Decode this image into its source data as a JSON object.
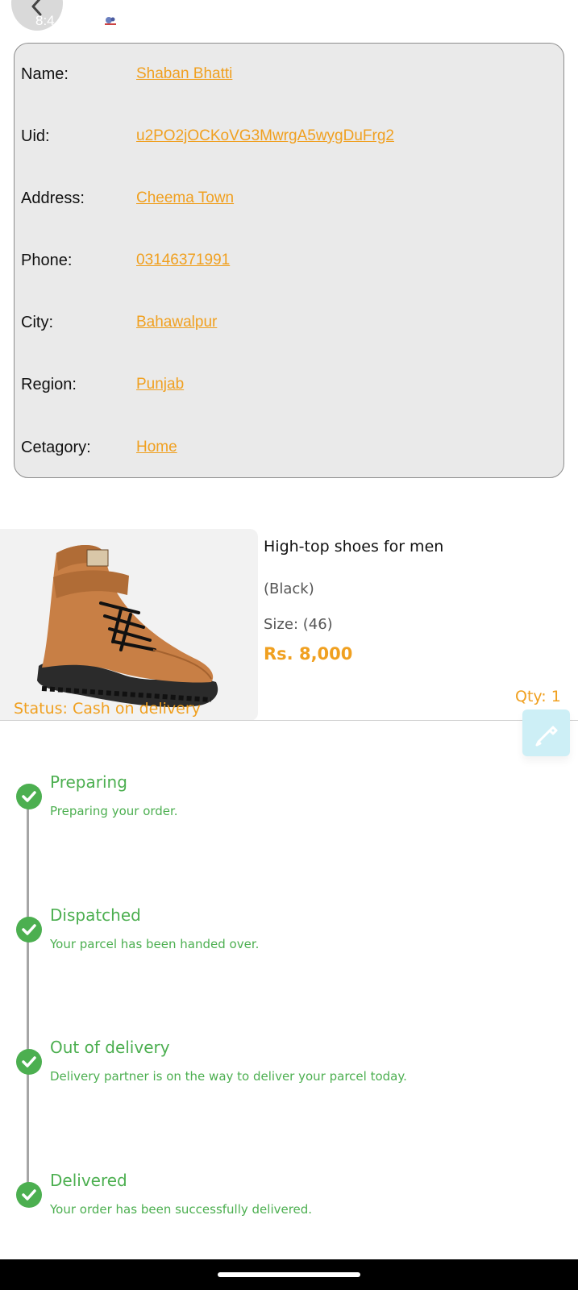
{
  "status_bar": {
    "time": "8:4"
  },
  "customer": {
    "rows": [
      {
        "label": "Name:",
        "value": "Shaban Bhatti"
      },
      {
        "label": "Uid:",
        "value": "u2PO2jOCKoVG3MwrgA5wygDuFrg2"
      },
      {
        "label": "Address:",
        "value": "Cheema Town"
      },
      {
        "label": "Phone:",
        "value": "03146371991"
      },
      {
        "label": "City:",
        "value": "Bahawalpur"
      },
      {
        "label": "Region:",
        "value": "Punjab"
      },
      {
        "label": "Cetagory:",
        "value": "Home"
      }
    ]
  },
  "product": {
    "title": "High-top shoes for men",
    "color": "(Black)",
    "size": "Size: (46)",
    "price": "Rs. 8,000",
    "qty": "Qty: 1",
    "status": "Status: Cash on delivery"
  },
  "timeline": {
    "steps": [
      {
        "title": "Preparing",
        "description": "Preparing your order."
      },
      {
        "title": "Dispatched",
        "description": "Your parcel has been handed over."
      },
      {
        "title": "Out of delivery",
        "description": "Delivery partner is on the way to deliver your parcel today."
      },
      {
        "title": "Delivered",
        "description": "Your order has been successfully delivered."
      }
    ]
  },
  "colors": {
    "accent": "#f0a020",
    "success": "#4caf50",
    "card_background": "#eaeaea",
    "fab_background": "#cdeff6"
  },
  "icons": [
    "chevron-left-icon",
    "notification-icon",
    "shoe-image",
    "edit-pen-icon",
    "check-circle-icon"
  ]
}
